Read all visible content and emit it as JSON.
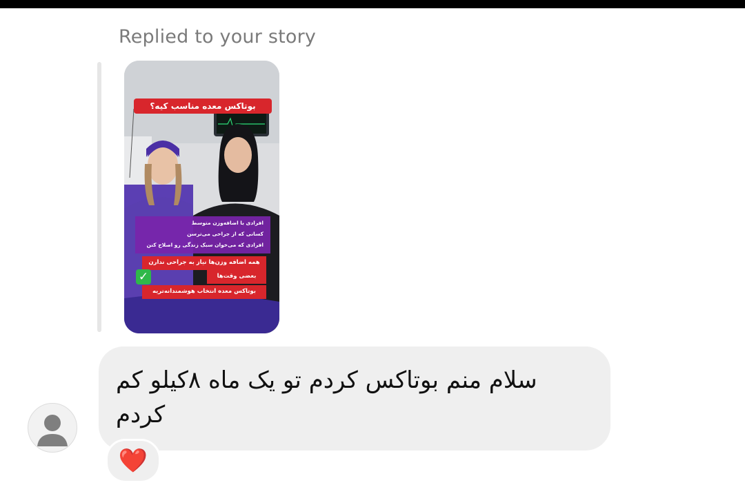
{
  "header": {
    "reply_label": "Replied to your story"
  },
  "story": {
    "title": "بوتاکس معده مناسب کیه؟",
    "purple_lines": [
      "افرادی با اضافه‌وزن متوسط",
      "کسانی که از جراحی می‌ترسن",
      "افرادی که می‌خوان سبک زندگی رو اصلاح کنن"
    ],
    "red_lines": [
      "همه اضافه وزن‌ها نیاز به جراحی ندارن",
      "بعضی وقت‌ها",
      "بوتاکس معده انتخاب هوشمندانه‌تریه"
    ],
    "check_glyph": "✓"
  },
  "message": {
    "text": "سلام منم بوتاکس کردم تو یک ماه ۸کیلو کم کردم",
    "reaction": "❤️"
  },
  "colors": {
    "bubble": "#efefef",
    "label": "#7a7a7a",
    "accent_red": "#d8262c",
    "accent_purple": "#7824aa"
  },
  "icons": {
    "avatar": "default-user-icon",
    "reaction": "heart-icon"
  }
}
